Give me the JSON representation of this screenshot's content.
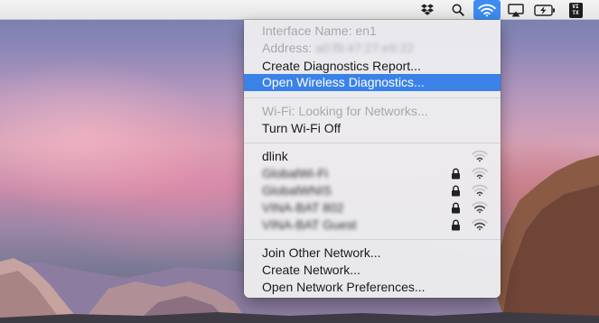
{
  "menubar": {
    "icons": [
      "dropbox-icon",
      "search-icon",
      "wifi-icon",
      "airplay-icon",
      "battery-charging-icon",
      "vitx-icon"
    ],
    "vitx_top": "VI",
    "vitx_bottom": "TX"
  },
  "wifi_menu": {
    "interface_name": "Interface Name: en1",
    "address_label": "Address:",
    "address_value": "a0:f9:47:27:e9:22",
    "create_diagnostics": "Create Diagnostics Report...",
    "open_wireless_diagnostics": "Open Wireless Diagnostics...",
    "wifi_status": "Wi-Fi: Looking for Networks...",
    "turn_wifi_off": "Turn Wi-Fi Off",
    "networks": [
      {
        "name": "dlink",
        "locked": false,
        "signal": 1
      },
      {
        "name": "GlobalWi-Fi",
        "locked": true,
        "signal": 1
      },
      {
        "name": "GlobalWNIS",
        "locked": true,
        "signal": 1
      },
      {
        "name": "VINA-BAT 802",
        "locked": true,
        "signal": 2
      },
      {
        "name": "VINA-BAT Guest",
        "locked": true,
        "signal": 2
      }
    ],
    "join_other": "Join Other Network...",
    "create_network": "Create Network...",
    "open_preferences": "Open Network Preferences..."
  },
  "colors": {
    "highlight": "#3b82e8",
    "menubar_wifi_active": "#3d8cf0",
    "disabled_text": "#a8a8ab"
  }
}
